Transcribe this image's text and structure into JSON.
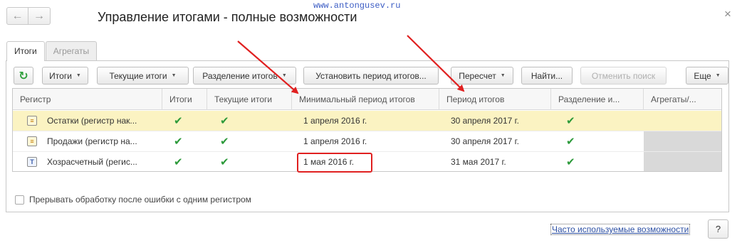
{
  "watermark": "www.antongusev.ru",
  "window": {
    "title": "Управление итогами - полные возможности",
    "back_glyph": "←",
    "forward_glyph": "→",
    "close_glyph": "×"
  },
  "tabs": [
    {
      "label": "Итоги",
      "active": true
    },
    {
      "label": "Агрегаты",
      "active": false
    }
  ],
  "toolbar": {
    "refresh_glyph": "↻",
    "itogi": "Итоги",
    "tekushchie": "Текущие итоги",
    "razdelenie": "Разделение итогов",
    "ustanovit": "Установить период итогов...",
    "pereschet": "Пересчет",
    "naiti": "Найти...",
    "otmenit": "Отменить поиск",
    "eshche": "Еще",
    "dropdown_glyph": "▼"
  },
  "grid": {
    "columns": [
      "Регистр",
      "Итоги",
      "Текущие итоги",
      "Минимальный период итогов",
      "Период итогов",
      "Разделение и...",
      "Агрегаты/..."
    ],
    "rows": [
      {
        "name": "Остатки (регистр нак...",
        "itogi": "✔",
        "tekushchie": "✔",
        "min_period": "1 апреля 2016 г.",
        "period": "30 апреля 2017 г.",
        "razdelenie": "✔",
        "icon": "accumulation-register-icon",
        "selected": true
      },
      {
        "name": "Продажи (регистр на...",
        "itogi": "✔",
        "tekushchie": "✔",
        "min_period": "1 апреля 2016 г.",
        "period": "30 апреля 2017 г.",
        "razdelenie": "✔",
        "icon": "accumulation-register-icon",
        "selected": false
      },
      {
        "name": "Хозрасчетный (регис...",
        "itogi": "✔",
        "tekushchie": "✔",
        "min_period": "1 мая 2016 г.",
        "period": "31 мая 2017 г.",
        "razdelenie": "✔",
        "icon": "accounting-register-icon",
        "selected": false
      }
    ],
    "row_icon_glyphs": {
      "accumulation": "≡",
      "accounting": "Т"
    }
  },
  "options": {
    "interrupt_label": "Прерывать обработку после ошибки с одним регистром",
    "interrupt_checked": false
  },
  "footer": {
    "link": "Часто используемые возможности",
    "help": "?"
  },
  "colors": {
    "selected_row": "#fbf3c2",
    "check": "#2c9a3a",
    "annotation": "#e02020",
    "link": "#2c4fa3"
  }
}
